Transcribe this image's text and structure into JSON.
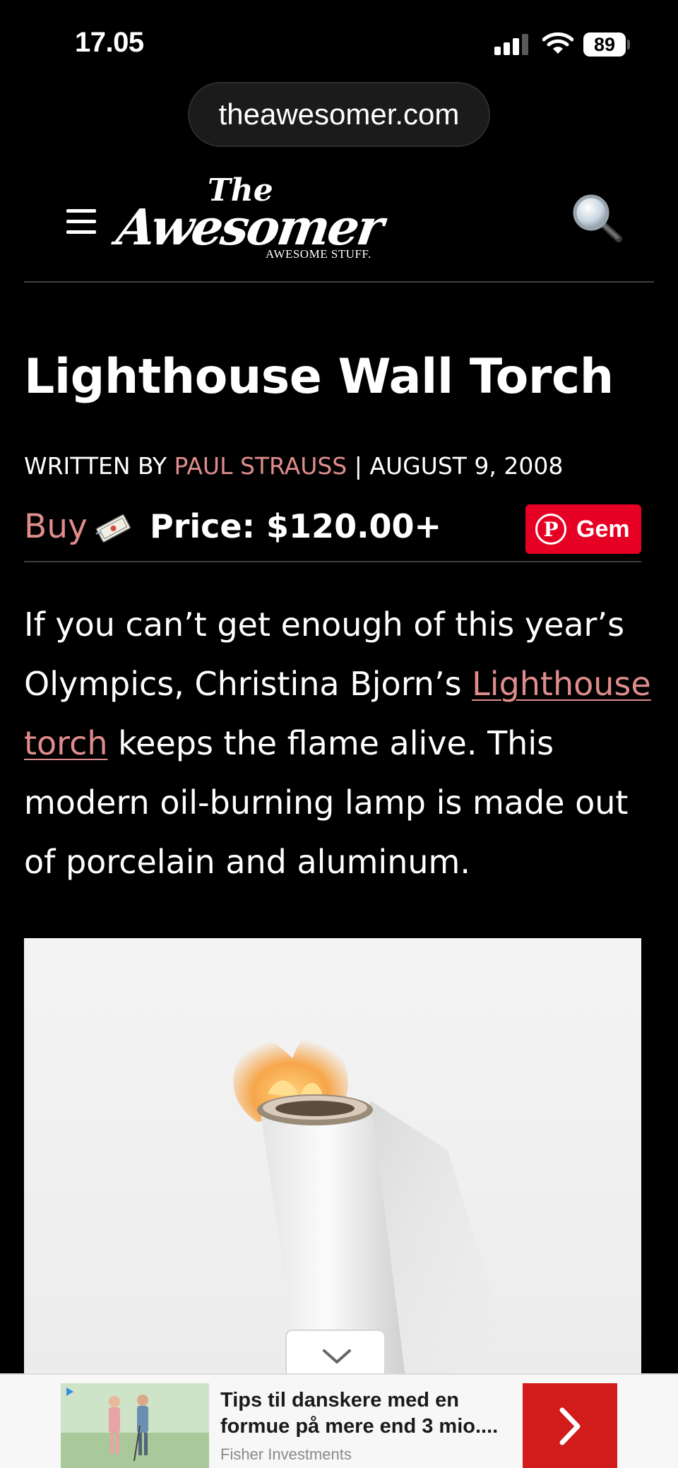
{
  "status_bar": {
    "time": "17.05",
    "battery": "89",
    "signal_bars_active": 3,
    "signal_bars_total": 4
  },
  "browser": {
    "url": "theawesomer.com"
  },
  "site": {
    "logo_the": "The",
    "logo_name": "Awesomer",
    "logo_tagline": "AWESOME STUFF."
  },
  "article": {
    "title": "Lighthouse Wall Torch",
    "byline_prefix": "WRITTEN BY ",
    "author": "PAUL STRAUSS",
    "byline_sep": " | ",
    "date": "AUGUST 9, 2008",
    "buy_label": "Buy",
    "price_label": "Price: $120.00+",
    "save_label": "Gem",
    "body_part1": "If you can’t get enough of this year’s Olympics, Christina Bjorn’s ",
    "body_link": "Lighthouse torch",
    "body_part2": " keeps the flame alive. This modern oil-burning lamp is made out of porcelain and aluminum."
  },
  "ad": {
    "headline": "Tips til danskere med en formue på mere end 3 mio....",
    "advertiser": "Fisher Investments"
  },
  "colors": {
    "accent": "#e08c8c",
    "pinterest": "#e60023",
    "ad_cta": "#d21b1b",
    "background": "#000000"
  }
}
